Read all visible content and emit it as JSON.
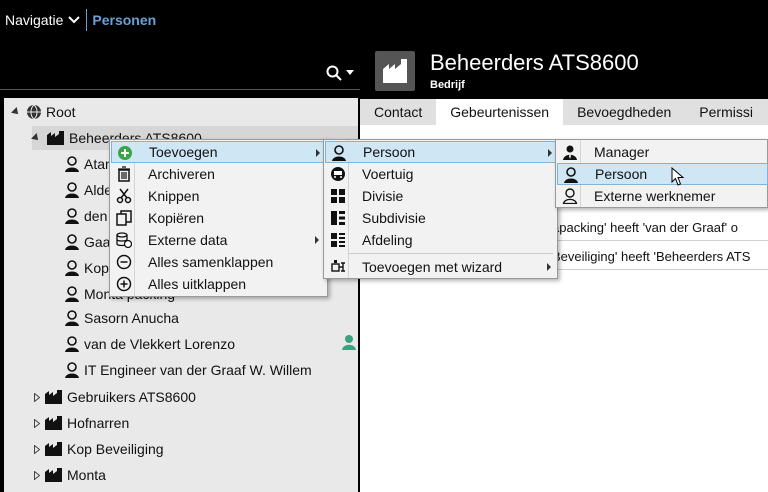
{
  "topbar": {
    "nav_label": "Navigatie",
    "breadcrumb": "Personen"
  },
  "header": {
    "title": "Beheerders ATS8600",
    "subtitle": "Bedrijf"
  },
  "tabs": [
    {
      "label": "Contact"
    },
    {
      "label": "Gebeurtenissen"
    },
    {
      "label": "Bevoegdheden"
    },
    {
      "label": "Permissi"
    }
  ],
  "tree": {
    "root": "Root",
    "items": [
      {
        "label": "Beheerders ATS8600"
      },
      {
        "label": "Atan"
      },
      {
        "label": "Alde"
      },
      {
        "label": "den"
      },
      {
        "label": "Gaa"
      },
      {
        "label": "Kop"
      },
      {
        "label": "Monta packing"
      },
      {
        "label": "Sasorn Anucha"
      },
      {
        "label": "van de Vlekkert Lorenzo"
      },
      {
        "label": "IT Engineer van der Graaf W. Willem"
      },
      {
        "label": "Gebruikers ATS8600"
      },
      {
        "label": "Hofnarren"
      },
      {
        "label": "Kop Beveiliging"
      },
      {
        "label": "Monta"
      }
    ]
  },
  "events": [
    {
      "text": "apacking' heeft 'van der Graaf' o"
    },
    {
      "text": "Beveiliging' heeft 'Beheerders ATS"
    }
  ],
  "menu1": {
    "add": "Toevoegen",
    "archive": "Archiveren",
    "cut": "Knippen",
    "copy": "Kopiëren",
    "external": "Externe data",
    "collapse": "Alles samenklappen",
    "expand": "Alles uitklappen"
  },
  "menu2": {
    "person": "Persoon",
    "vehicle": "Voertuig",
    "division": "Divisie",
    "subdivision": "Subdivisie",
    "department": "Afdeling",
    "wizard": "Toevoegen met wizard"
  },
  "menu3": {
    "manager": "Manager",
    "person": "Persoon",
    "external": "Externe werknemer"
  }
}
